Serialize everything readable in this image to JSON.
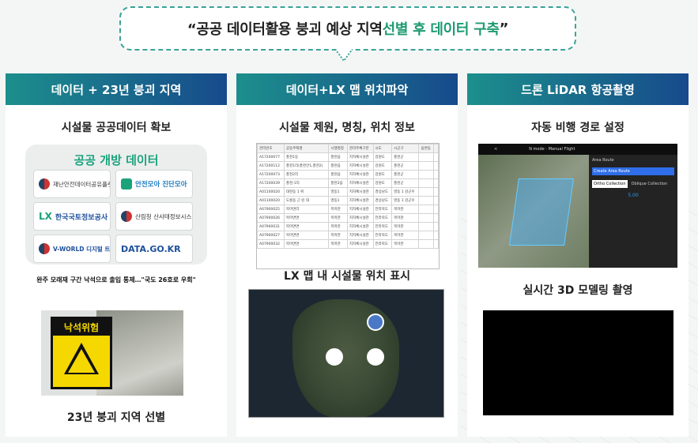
{
  "headline": {
    "quote_open": "“공공 데이터활용 붕괴 예상 지역 ",
    "highlight": "선별 후 데이터 구축",
    "quote_close": "”"
  },
  "panels": [
    {
      "header": "데이터 + 23년 붕괴 지역",
      "subtitle": "시설물 공공데이터 확보",
      "open_data_title": "공공 개방 데이터",
      "logos": [
        "재난안전데이터공유플랫폼",
        "안전모아 진단모아",
        "한국국토정보공사",
        "산림청 산사태정보시스템",
        "V-WORLD 디지털 트윈국토",
        "DATA.GO.KR"
      ],
      "news_headline": "완주 모래재 구간 낙석으로 출입 통제…\"국도 26호로 우회\"",
      "sign_text": "낙석위험",
      "footer": "23년 붕괴 지역 선별"
    },
    {
      "header": "데이터+LX 맵 위치파악",
      "subtitle": "시설물 제원, 명칭, 위치 정보",
      "table_headers": [
        "관리번호",
        "공동주택명",
        "시행명칭",
        "관리주체구분",
        "시도",
        "시군구",
        "읍면동",
        ""
      ],
      "table_rows": [
        [
          "A17200077",
          "풍천1동",
          "풍천읍",
          "지자체시설관",
          "강원도",
          "풍천군",
          ""
        ],
        [
          "A17200112",
          "풍천1리(풍천안1,풍천2)",
          "풍천읍",
          "지자체시설관",
          "강원도",
          "풍천군",
          ""
        ],
        [
          "A17200073",
          "풍천2리",
          "풍천읍",
          "지자체시설관",
          "강원도",
          "풍천군",
          ""
        ],
        [
          "A17200039",
          "풍천-1리",
          "풍천2읍",
          "지자체시설관",
          "강원도",
          "풍천군",
          ""
        ],
        [
          "A01100020",
          "대현동 1 위",
          "영동1",
          "지자체시설관",
          "경상남도",
          "영동 1 감군우",
          ""
        ],
        [
          "A01100020",
          "도롱동 근 린 대",
          "영동1",
          "지자체시설관",
          "경상남도",
          "영동 1 감군우",
          ""
        ],
        [
          "A07900025",
          "목마면리",
          "목마관",
          "지자체시설관",
          "전라북도",
          "목마관",
          ""
        ],
        [
          "A07900026",
          "목마면면",
          "목마관",
          "지자체시설관",
          "전라북도",
          "목마관",
          ""
        ],
        [
          "A07900031",
          "목마면면",
          "목마관",
          "지자체시설관",
          "전라북도",
          "목마관",
          ""
        ],
        [
          "A07900027",
          "목마면면",
          "목마관",
          "지자체시설관",
          "전라북도",
          "목마관",
          ""
        ],
        [
          "A07900032",
          "목마면면",
          "목마관",
          "지자체시설관",
          "전라북도",
          "목마관",
          ""
        ]
      ],
      "map_caption": "LX 맵 내 시설물 위치 표시"
    },
    {
      "header": "드론 LiDAR 항공촬영",
      "subtitle": "자동 비행 경로 설정",
      "drone_mode": "N mode - Manual Flight",
      "area_route": "Area Route",
      "create_btn": "Create Area Route",
      "ortho": "Ortho Collection",
      "oblique": "Oblique Collection",
      "gsd_value": "5.00",
      "footer": "실시간 3D 모델링 촬영"
    }
  ],
  "colors": {
    "header_start": "#1c8f8c",
    "header_end": "#174a8c",
    "highlight": "#1f9a72",
    "open_data": "#1aa37b"
  }
}
